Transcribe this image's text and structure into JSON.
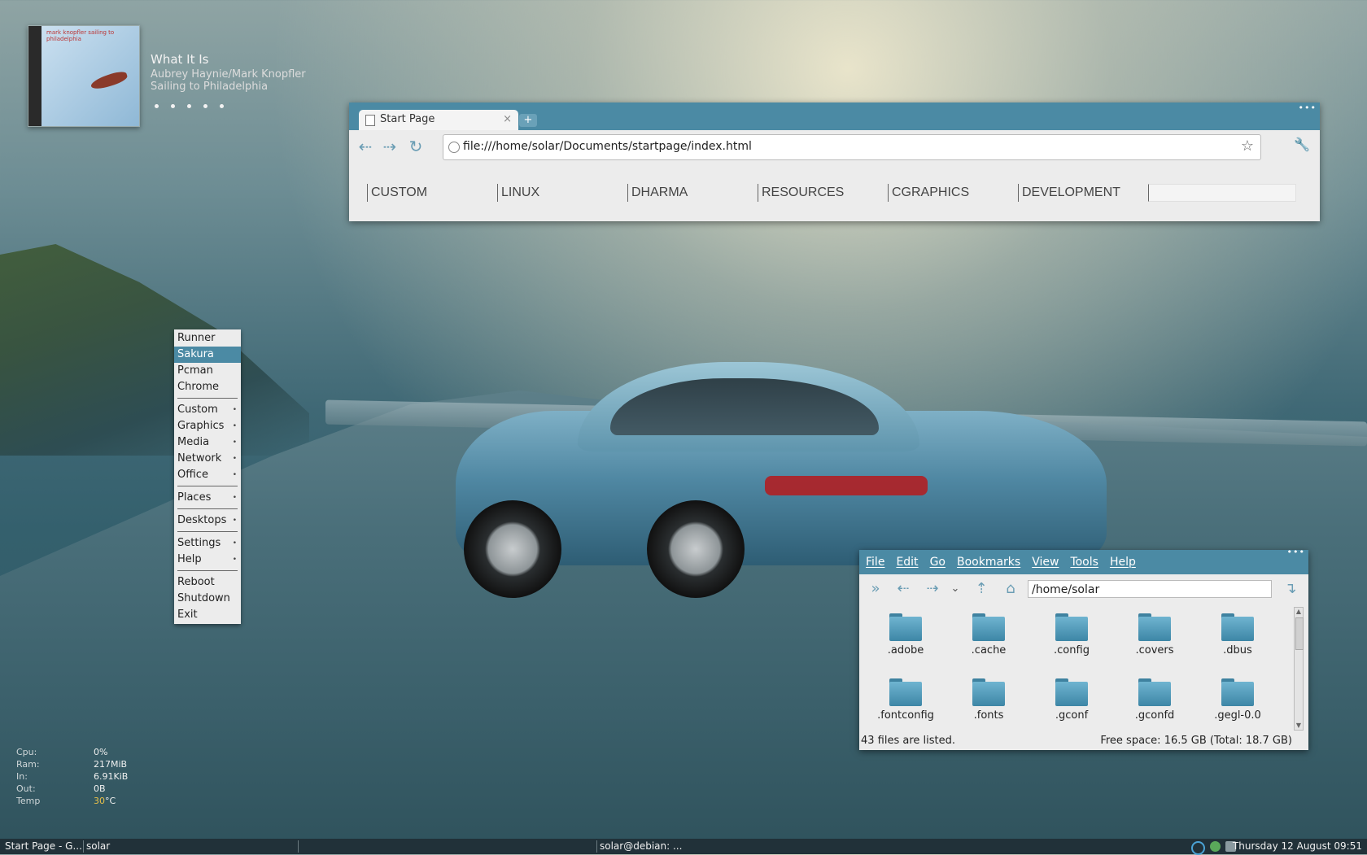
{
  "now_playing": {
    "cover_text": "mark knopfler   sailing to philadelphia",
    "title": "What It Is",
    "artist": "Aubrey Haynie/Mark Knopfler",
    "album": "Sailing to Philadelphia",
    "rating_dots": 5
  },
  "browser": {
    "tab_label": "Start Page",
    "tab_close": "×",
    "new_tab": "+",
    "url": "file:///home/solar/Documents/startpage/index.html",
    "startpage_links": [
      "CUSTOM",
      "LINUX",
      "DHARMA",
      "RESOURCES",
      "CGRAPHICS",
      "DEVELOPMENT"
    ]
  },
  "menu": {
    "items": [
      "Runner",
      "Sakura",
      "Pcman",
      "Chrome"
    ],
    "active": "Sakura",
    "submenus_1": [
      "Custom",
      "Graphics",
      "Media",
      "Network",
      "Office"
    ],
    "places": "Places",
    "desktops": "Desktops",
    "submenus_2": [
      "Settings",
      "Help"
    ],
    "actions": [
      "Reboot",
      "Shutdown",
      "Exit"
    ]
  },
  "file_manager": {
    "menus": [
      "File",
      "Edit",
      "Go",
      "Bookmarks",
      "View",
      "Tools",
      "Help"
    ],
    "path": "/home/solar",
    "folders": [
      ".adobe",
      ".cache",
      ".config",
      ".covers",
      ".dbus",
      ".fontconfig",
      ".fonts",
      ".gconf",
      ".gconfd",
      ".gegl-0.0"
    ],
    "status_left": "43 files are listed.",
    "status_right": "Free space: 16.5 GB (Total: 18.7 GB)",
    "folder_color": "#4a94b4"
  },
  "conky": {
    "rows": [
      {
        "k": "Cpu:",
        "v": "0%"
      },
      {
        "k": "Ram:",
        "v": "217MiB"
      },
      {
        "k": "In:",
        "v": "6.91KiB"
      },
      {
        "k": "Out:",
        "v": "0B"
      }
    ],
    "temp_label": "Temp",
    "temp_value": "30",
    "temp_unit": "°C"
  },
  "taskbar": {
    "task1": "Start Page - G...",
    "task2": "solar",
    "task3": "solar@debian: ...",
    "clock": "Thursday  12  August  09:51"
  },
  "colors": {
    "accent": "#4b8aa4",
    "panel_bg": "#ececec",
    "temp_highlight": "#e8c04a"
  }
}
